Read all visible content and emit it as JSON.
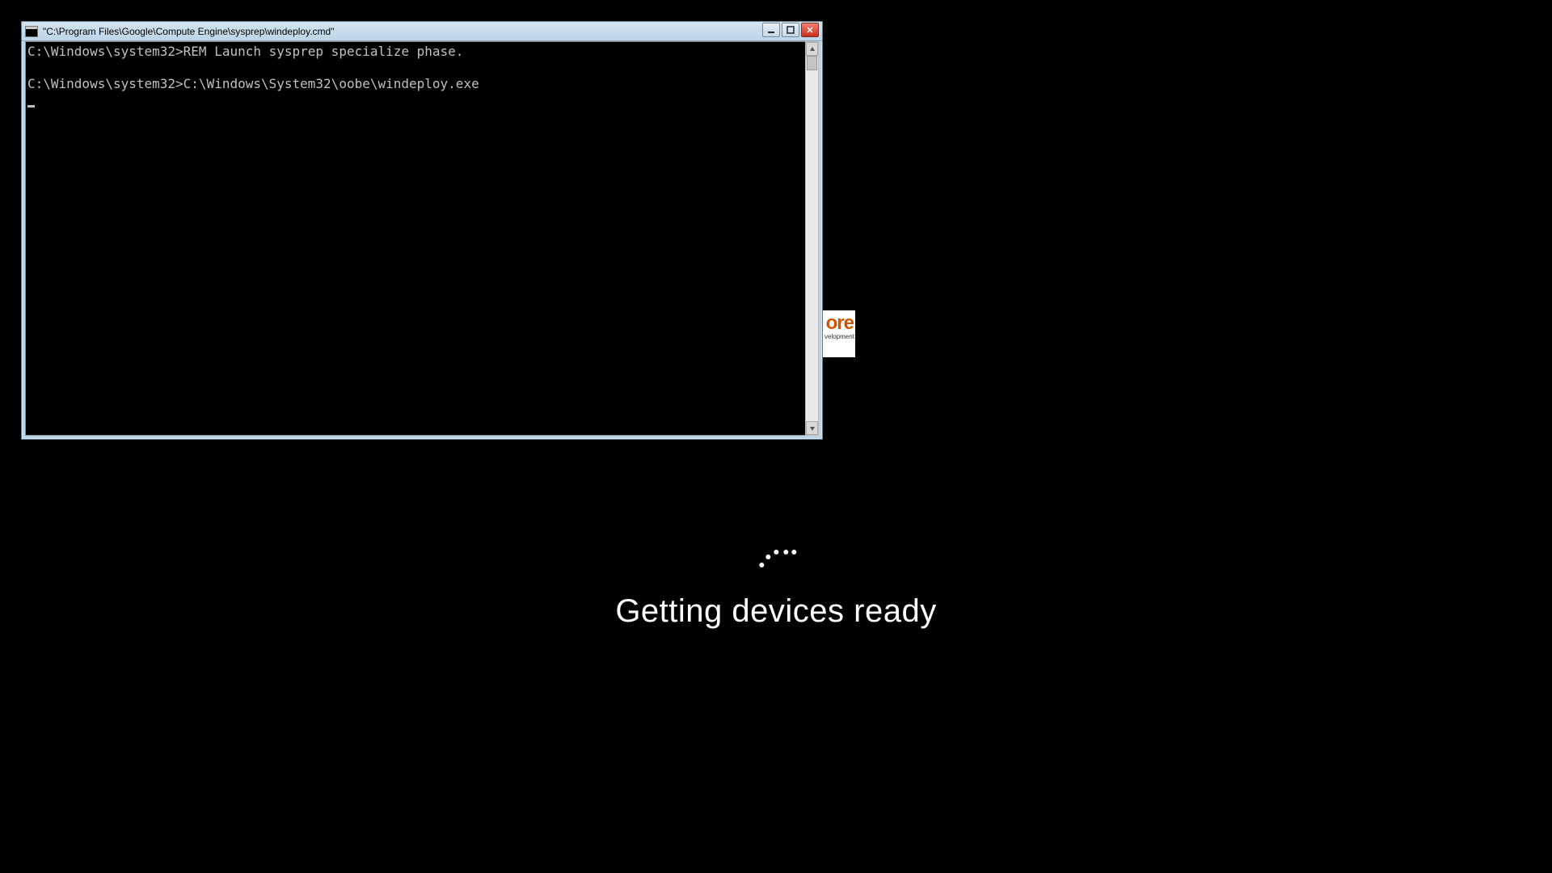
{
  "oobe": {
    "message": "Getting devices ready"
  },
  "watermark": {
    "fragment_top": "ore",
    "fragment_bottom": "velopment"
  },
  "cmd": {
    "title": "\"C:\\Program Files\\Google\\Compute Engine\\sysprep\\windeploy.cmd\"",
    "lines": [
      "C:\\Windows\\system32>REM Launch sysprep specialize phase.",
      "",
      "C:\\Windows\\system32>C:\\Windows\\System32\\oobe\\windeploy.exe"
    ]
  }
}
